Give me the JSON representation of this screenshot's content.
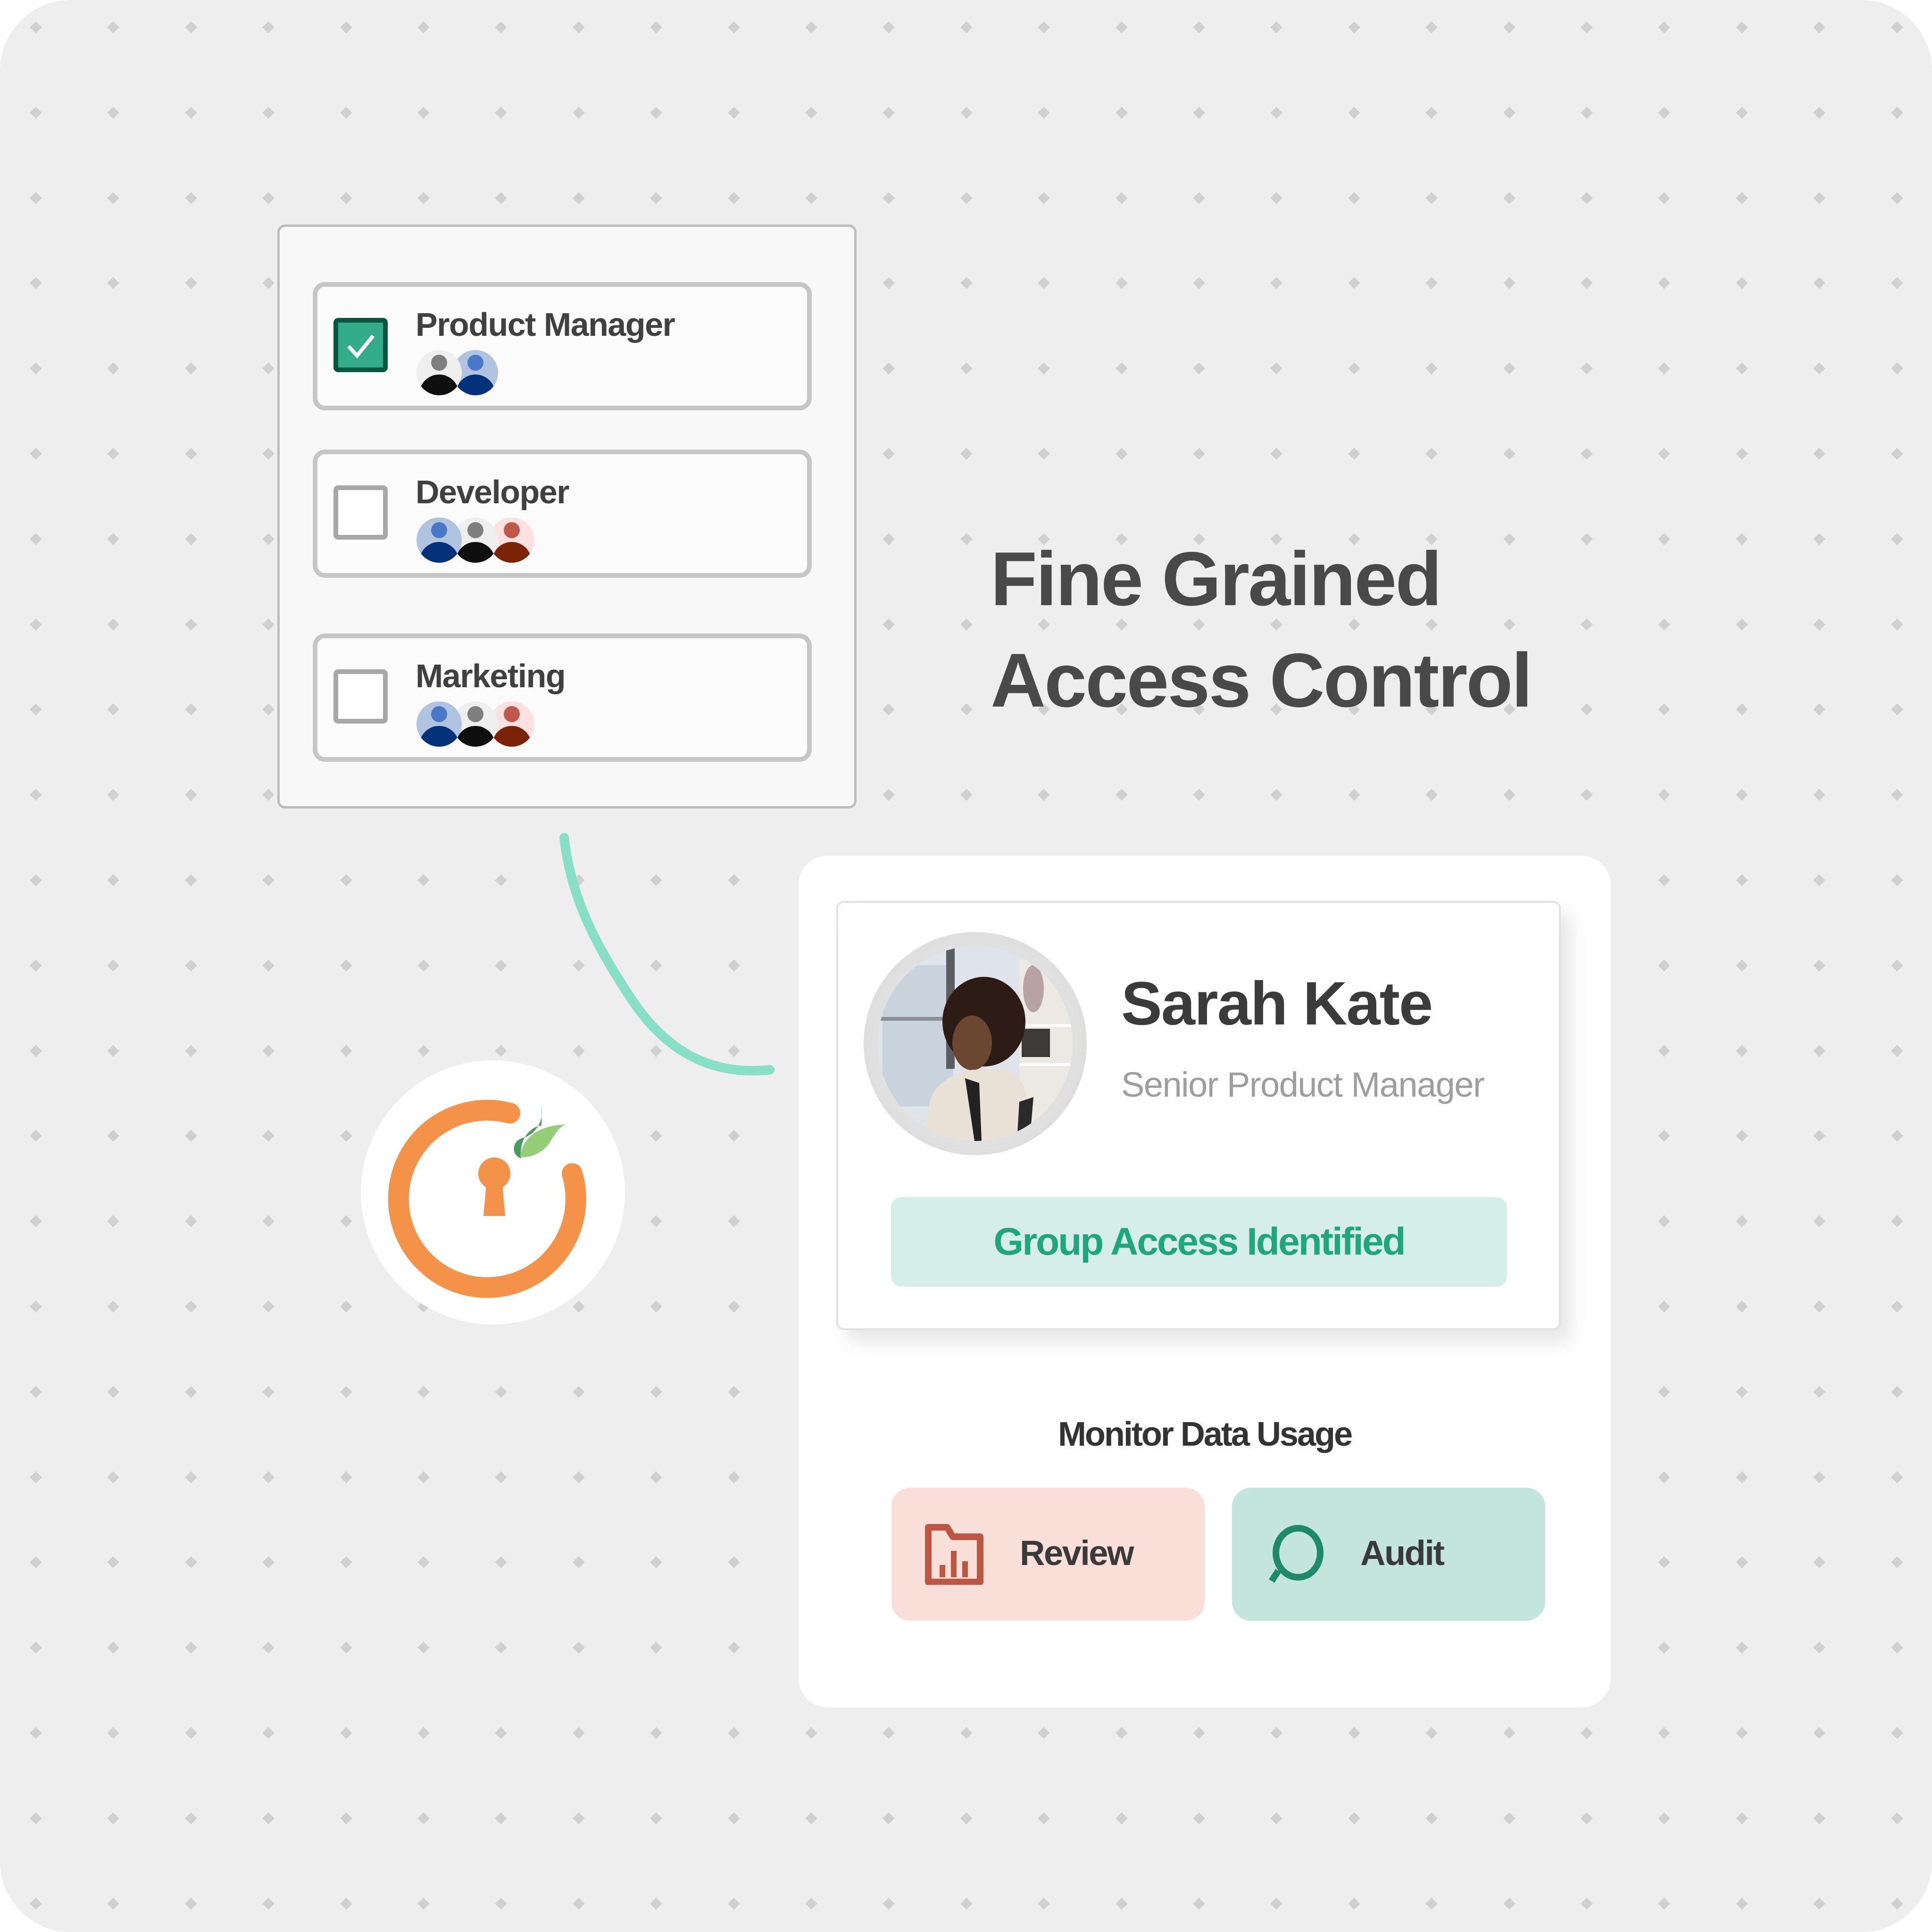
{
  "roles_panel": {
    "items": [
      {
        "label": "Product Manager",
        "checked": true,
        "avatars": [
          {
            "bg": "#efefef",
            "head": "#7f7f7f",
            "body": "#0f0f0f"
          },
          {
            "bg": "#b0c4e0",
            "head": "#4a78c8",
            "body": "#03317a"
          }
        ]
      },
      {
        "label": "Developer",
        "checked": false,
        "avatars": [
          {
            "bg": "#b0c4e0",
            "head": "#4a78c8",
            "body": "#03317a"
          },
          {
            "bg": "#efefef",
            "head": "#7f7f7f",
            "body": "#0f0f0f"
          },
          {
            "bg": "#fde1e1",
            "head": "#c0584a",
            "body": "#7a2307"
          }
        ]
      },
      {
        "label": "Marketing",
        "checked": false,
        "avatars": [
          {
            "bg": "#b0c4e0",
            "head": "#4a78c8",
            "body": "#03317a"
          },
          {
            "bg": "#efefef",
            "head": "#7f7f7f",
            "body": "#0f0f0f"
          },
          {
            "bg": "#fde1e1",
            "head": "#c0584a",
            "body": "#7a2307"
          }
        ]
      }
    ]
  },
  "hero": {
    "title_line1": "Fine Grained",
    "title_line2": "Access Control"
  },
  "logo": {
    "icon": "keyhole-leaf-logo",
    "ring_color": "#f5924a",
    "leaf_dark": "#4a9a63",
    "leaf_light": "#96cd78"
  },
  "connector": {
    "color": "#87dfc6"
  },
  "profile": {
    "name": "Sarah Kate",
    "title": "Senior Product Manager",
    "badge": "Group Access Identified"
  },
  "monitor": {
    "title": "Monitor Data Usage",
    "buttons": [
      {
        "label": "Review",
        "icon": "folder-chart-icon",
        "bg": "#f9dfd8",
        "icon_color": "#bd5744"
      },
      {
        "label": "Audit",
        "icon": "magnifier-icon",
        "bg": "#c3e5db",
        "icon_color": "#1f8a6a"
      }
    ]
  },
  "colors": {
    "background": "#eeeeee",
    "dot": "#d0d0d0",
    "accent_green": "#1fa67c",
    "checkbox_checked": "#33ac89",
    "text_dark": "#404040"
  }
}
